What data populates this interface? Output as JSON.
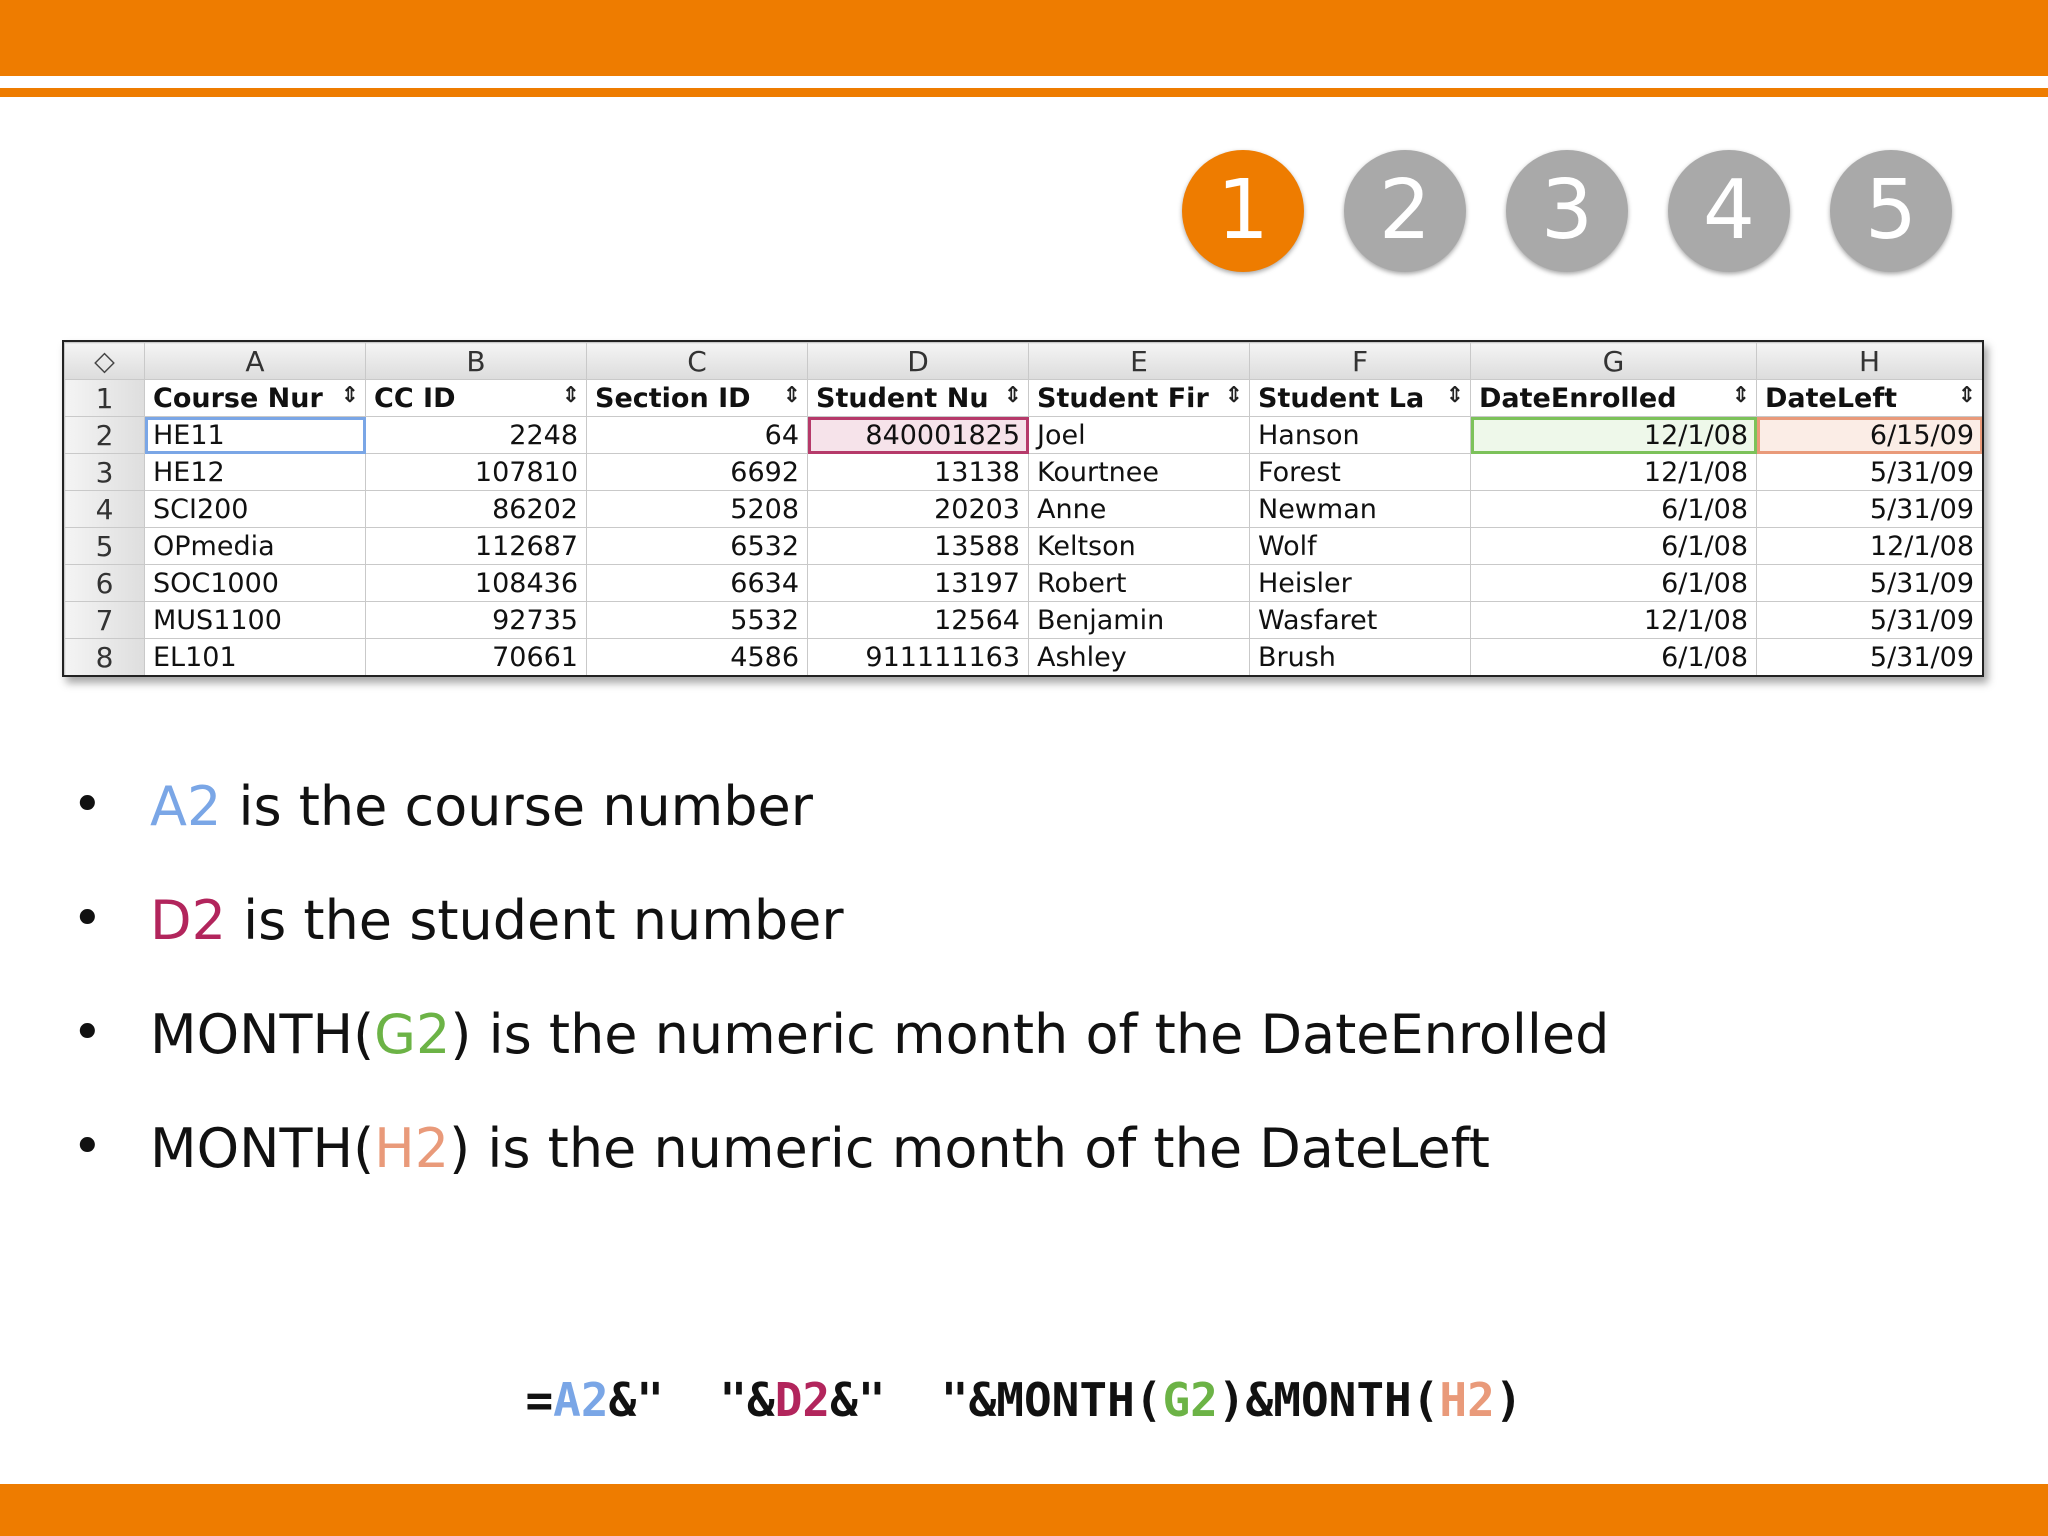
{
  "steps": [
    "1",
    "2",
    "3",
    "4",
    "5"
  ],
  "sheet": {
    "corner_icon": "◇",
    "columns": [
      "A",
      "B",
      "C",
      "D",
      "E",
      "F",
      "G",
      "H"
    ],
    "headers": [
      "Course Nur",
      "CC ID",
      "Section ID",
      "Student Nu",
      "Student Fir",
      "Student La",
      "DateEnrolled",
      "DateLeft"
    ],
    "filter_icon": "⇕",
    "rows": [
      {
        "num": "2",
        "cells": [
          "HE11",
          "2248",
          "64",
          "840001825",
          "Joel",
          "Hanson",
          "12/1/08",
          "6/15/09"
        ]
      },
      {
        "num": "3",
        "cells": [
          "HE12",
          "107810",
          "6692",
          "13138",
          "Kourtnee",
          "Forest",
          "12/1/08",
          "5/31/09"
        ]
      },
      {
        "num": "4",
        "cells": [
          "SCI200",
          "86202",
          "5208",
          "20203",
          "Anne",
          "Newman",
          "6/1/08",
          "5/31/09"
        ]
      },
      {
        "num": "5",
        "cells": [
          "OPmedia",
          "112687",
          "6532",
          "13588",
          "Keltson",
          "Wolf",
          "6/1/08",
          "12/1/08"
        ]
      },
      {
        "num": "6",
        "cells": [
          "SOC1000",
          "108436",
          "6634",
          "13197",
          "Robert",
          "Heisler",
          "6/1/08",
          "5/31/09"
        ]
      },
      {
        "num": "7",
        "cells": [
          "MUS1100",
          "92735",
          "5532",
          "12564",
          "Benjamin",
          "Wasfaret",
          "12/1/08",
          "5/31/09"
        ]
      },
      {
        "num": "8",
        "cells": [
          "EL101",
          "70661",
          "4586",
          "911111163",
          "Ashley",
          "Brush",
          "6/1/08",
          "5/31/09"
        ]
      }
    ],
    "header_row_num": "1"
  },
  "bullets": [
    {
      "prefix": "",
      "ref": "A2",
      "suffix": " is the course number"
    },
    {
      "prefix": "",
      "ref": "D2",
      "suffix": " is the student number"
    },
    {
      "prefix": "MONTH(",
      "ref": "G2",
      "suffix": ") is the numeric month of the DateEnrolled"
    },
    {
      "prefix": "MONTH(",
      "ref": "H2",
      "suffix": ") is the numeric month of the DateLeft"
    }
  ],
  "bullet_glyph": "•",
  "formula": {
    "p1": "=",
    "r1": "A2",
    "p2": "&\"  \"&",
    "r2": "D2",
    "p3": "&\"  \"&MONTH(",
    "r3": "G2",
    "p4": ")&MONTH(",
    "r4": "H2",
    "p5": ")"
  },
  "colors": {
    "brand": "#EE7C00",
    "step_inactive": "#A9A9A9",
    "a2": "#7AA6E6",
    "d2": "#B2255C",
    "g2": "#6CB346",
    "h2": "#E99A7A"
  }
}
